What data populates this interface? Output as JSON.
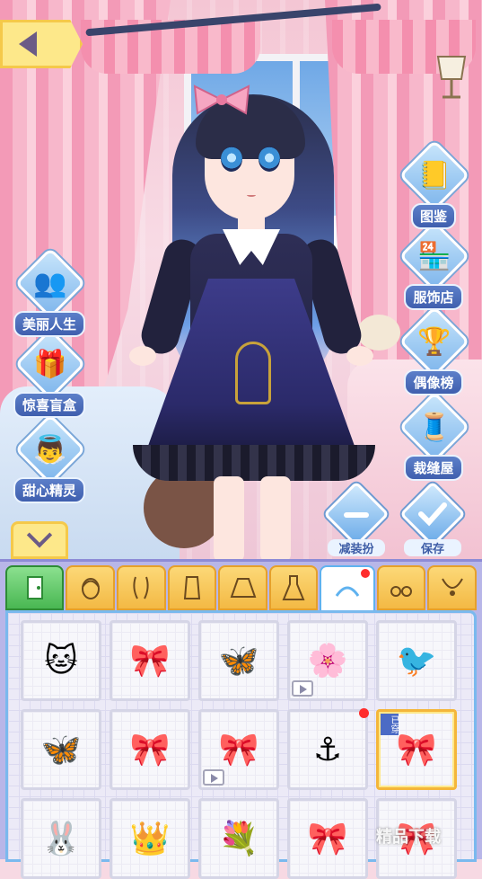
{
  "menu_left": [
    {
      "label": "美丽人生",
      "icon": "heads-icon"
    },
    {
      "label": "惊喜盲盒",
      "icon": "gift-box-icon"
    },
    {
      "label": "甜心精灵",
      "icon": "angel-icon"
    }
  ],
  "menu_right": [
    {
      "label": "图鉴",
      "icon": "album-icon"
    },
    {
      "label": "服饰店",
      "icon": "shop-icon"
    },
    {
      "label": "偶像榜",
      "icon": "trophy-icon"
    },
    {
      "label": "裁缝屋",
      "icon": "sewing-machine-icon"
    }
  ],
  "actions": {
    "remove_label": "减装扮",
    "save_label": "保存"
  },
  "tabs": [
    "exit",
    "hairstyle",
    "hair",
    "top",
    "skirt",
    "dress",
    "headwear",
    "earrings",
    "necklace"
  ],
  "active_tab": "headwear",
  "items": [
    {
      "name": "cat-badge",
      "glyph": "🐱",
      "video": false
    },
    {
      "name": "ribbon-headband",
      "glyph": "🎀",
      "video": false
    },
    {
      "name": "butterfly-clip",
      "glyph": "🦋",
      "video": false
    },
    {
      "name": "floral-headband",
      "glyph": "🌸",
      "video": true
    },
    {
      "name": "swallow-hairpin",
      "glyph": "🐦",
      "video": false
    },
    {
      "name": "butterfly-chain",
      "glyph": "🦋",
      "video": false
    },
    {
      "name": "lilac-bow",
      "glyph": "🎀",
      "video": false
    },
    {
      "name": "brown-bow",
      "glyph": "🎀",
      "video": true
    },
    {
      "name": "sailor-cap",
      "glyph": "⚓",
      "video": false,
      "new": true
    },
    {
      "name": "pink-bow",
      "glyph": "🎀",
      "video": false,
      "worn": true
    },
    {
      "name": "bunny-ears",
      "glyph": "🐰",
      "video": false
    },
    {
      "name": "bow-crown",
      "glyph": "👑",
      "video": false
    },
    {
      "name": "veil",
      "glyph": "💐",
      "video": false
    },
    {
      "name": "red-bows",
      "glyph": "🎀",
      "video": false
    },
    {
      "name": "red-bow-2",
      "glyph": "🎀",
      "video": false
    }
  ],
  "worn_badge": "已穿",
  "watermark": "精品下载",
  "colors": {
    "accent": "#4c6bc5",
    "tab": "#f3b944",
    "panel": "#b8b6e8"
  }
}
